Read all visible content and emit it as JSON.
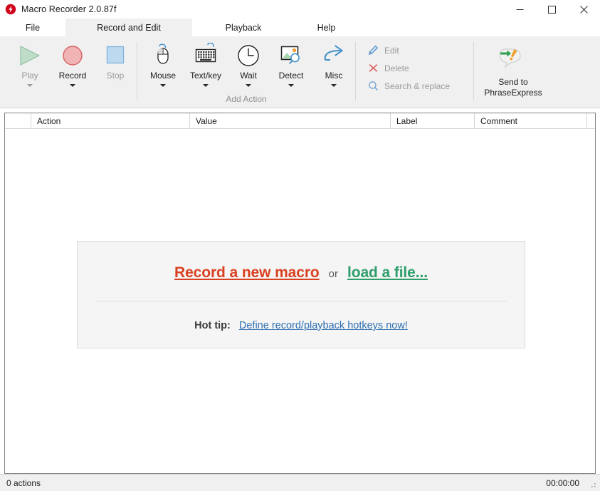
{
  "window": {
    "title": "Macro Recorder 2.0.87f",
    "app_icon": "lightning-bolt-icon",
    "minimize_label": "─",
    "maximize_label": "□",
    "close_label": "✕"
  },
  "tabs": [
    {
      "label": "File",
      "active": false
    },
    {
      "label": "Record and Edit",
      "active": true
    },
    {
      "label": "Playback",
      "active": false
    },
    {
      "label": "Help",
      "active": false
    }
  ],
  "ribbon": {
    "buttons": [
      {
        "label": "Play",
        "icon": "play-triangle-icon",
        "disabled": true,
        "has_caret": true
      },
      {
        "label": "Record",
        "icon": "record-circle-icon",
        "disabled": false,
        "has_caret": true
      },
      {
        "label": "Stop",
        "icon": "stop-square-icon",
        "disabled": true,
        "has_caret": false
      },
      {
        "label": "Mouse",
        "icon": "mouse-icon",
        "disabled": false,
        "has_caret": true
      },
      {
        "label": "Text/key",
        "icon": "keyboard-icon",
        "disabled": false,
        "has_caret": true
      },
      {
        "label": "Wait",
        "icon": "clock-icon",
        "disabled": false,
        "has_caret": true
      },
      {
        "label": "Detect",
        "icon": "image-search-icon",
        "disabled": false,
        "has_caret": true
      },
      {
        "label": "Misc",
        "icon": "curved-arrow-icon",
        "disabled": false,
        "has_caret": true
      }
    ],
    "group_label": "Add Action",
    "commands": [
      {
        "label": "Edit",
        "icon": "pencil-icon"
      },
      {
        "label": "Delete",
        "icon": "x-cross-icon"
      },
      {
        "label": "Search & replace",
        "icon": "magnifier-icon"
      }
    ],
    "send_to": {
      "line1": "Send to",
      "line2": "PhraseExpress",
      "icon": "phraseexpress-bubble-icon"
    }
  },
  "grid": {
    "columns": [
      "Action",
      "Value",
      "Label",
      "Comment"
    ],
    "rows": []
  },
  "center_panel": {
    "record_link": "Record a new macro",
    "or_text": "or",
    "load_link": "load a file...",
    "tip_label": "Hot tip:",
    "tip_link": "Define record/playback hotkeys now!"
  },
  "status": {
    "actions_text": "0 actions",
    "time": "00:00:00"
  },
  "colors": {
    "record_red": "#d94020",
    "load_green": "#2e9e6b",
    "tip_blue": "#2f6fb0",
    "ribbon_bg": "#f0f0f0",
    "panel_bg": "#f5f5f5"
  }
}
